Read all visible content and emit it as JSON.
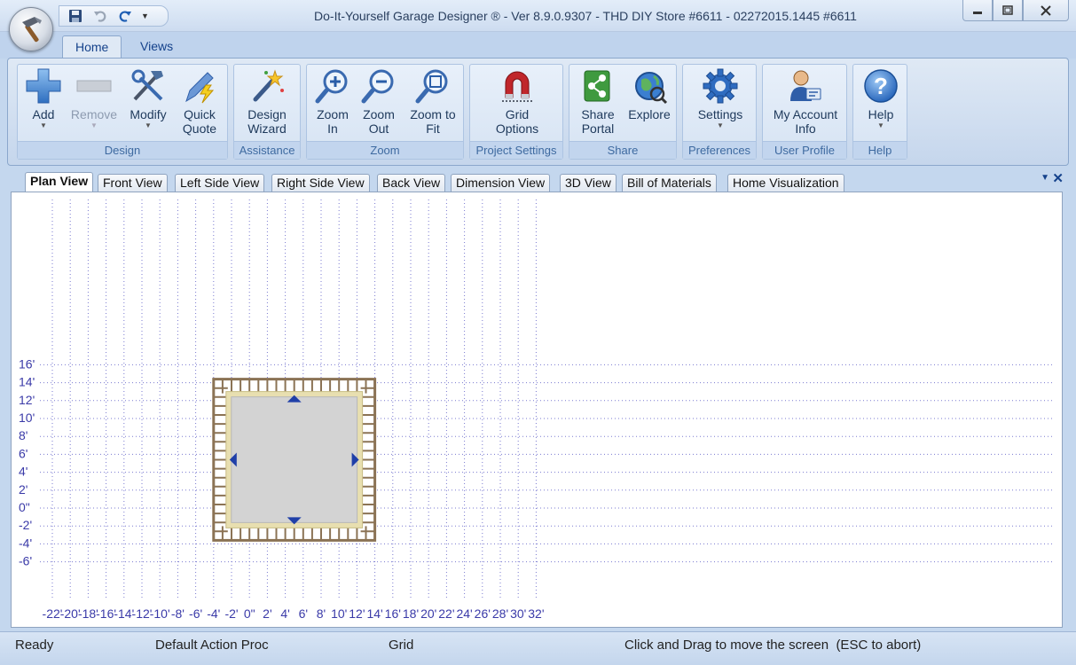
{
  "window": {
    "title": "Do-It-Yourself Garage Designer ® - Ver 8.9.0.9307 - THD DIY Store #6611 - 02272015.1445 #6611"
  },
  "quick_access": [
    "save-icon",
    "undo-icon",
    "redo-icon",
    "customize-dropdown"
  ],
  "ribbon_tabs": [
    {
      "label": "Home",
      "active": true
    },
    {
      "label": "Views",
      "active": false
    }
  ],
  "ribbon_groups": [
    {
      "label": "Design",
      "buttons": [
        {
          "line1": "Add",
          "line2": "",
          "icon": "plus-icon",
          "dropdown": true,
          "enabled": true
        },
        {
          "line1": "Remove",
          "line2": "",
          "icon": "minus-icon",
          "dropdown": true,
          "enabled": false
        },
        {
          "line1": "Modify",
          "line2": "",
          "icon": "tools-icon",
          "dropdown": true,
          "enabled": true
        },
        {
          "line1": "Quick",
          "line2": "Quote",
          "icon": "pen-lightning-icon",
          "dropdown": false,
          "enabled": true
        }
      ]
    },
    {
      "label": "Assistance",
      "buttons": [
        {
          "line1": "Design",
          "line2": "Wizard",
          "icon": "magic-wand-icon",
          "dropdown": false,
          "enabled": true
        }
      ]
    },
    {
      "label": "Zoom",
      "buttons": [
        {
          "line1": "Zoom",
          "line2": "In",
          "icon": "zoom-in-icon",
          "dropdown": false,
          "enabled": true
        },
        {
          "line1": "Zoom",
          "line2": "Out",
          "icon": "zoom-out-icon",
          "dropdown": false,
          "enabled": true
        },
        {
          "line1": "Zoom to",
          "line2": "Fit",
          "icon": "zoom-fit-icon",
          "dropdown": false,
          "enabled": true
        }
      ]
    },
    {
      "label": "Project Settings",
      "buttons": [
        {
          "line1": "Grid",
          "line2": "Options",
          "icon": "magnet-icon",
          "dropdown": false,
          "enabled": true
        }
      ]
    },
    {
      "label": "Share",
      "buttons": [
        {
          "line1": "Share",
          "line2": "Portal",
          "icon": "share-portal-icon",
          "dropdown": false,
          "enabled": true
        },
        {
          "line1": "Explore",
          "line2": "",
          "icon": "globe-icon",
          "dropdown": false,
          "enabled": true
        }
      ]
    },
    {
      "label": "Preferences",
      "buttons": [
        {
          "line1": "Settings",
          "line2": "",
          "icon": "gear-icon",
          "dropdown": true,
          "enabled": true
        }
      ]
    },
    {
      "label": "User Profile",
      "buttons": [
        {
          "line1": "My Account",
          "line2": "Info",
          "icon": "user-account-icon",
          "dropdown": false,
          "enabled": true
        }
      ]
    },
    {
      "label": "Help",
      "buttons": [
        {
          "line1": "Help",
          "line2": "",
          "icon": "help-icon",
          "dropdown": true,
          "enabled": true
        }
      ]
    }
  ],
  "view_tabs": [
    {
      "label": "Plan View",
      "active": true
    },
    {
      "label": "Front View",
      "active": false
    },
    {
      "label": "Left Side View",
      "active": false
    },
    {
      "label": "Right Side View",
      "active": false
    },
    {
      "label": "Back View",
      "active": false
    },
    {
      "label": "Dimension View",
      "active": false
    },
    {
      "label": "3D View",
      "active": false
    },
    {
      "label": "Bill of Materials",
      "active": false
    },
    {
      "label": "Home Visualization",
      "active": false
    }
  ],
  "plan": {
    "x_labels": [
      "-22'",
      "-20'",
      "-18'",
      "-16'",
      "-14'",
      "-12'",
      "-10'",
      "-8'",
      "-6'",
      "-4'",
      "-2'",
      "0\"",
      "2'",
      "4'",
      "6'",
      "8'",
      "10'",
      "12'",
      "14'",
      "16'",
      "18'",
      "20'",
      "22'",
      "24'",
      "26'",
      "28'",
      "30'",
      "32'"
    ],
    "y_labels": [
      "16'",
      "14'",
      "12'",
      "10'",
      "8'",
      "6'",
      "4'",
      "2'",
      "0\"",
      "-2'",
      "-4'",
      "-6'"
    ],
    "garage": {
      "x_min_ft": -4,
      "x_max_ft": 14,
      "y_min_ft": -4,
      "y_max_ft": 14,
      "inner_x_min_ft": -3.2,
      "inner_x_max_ft": 13.2,
      "inner_y_min_ft": -3.2,
      "inner_y_max_ft": 13.2
    },
    "colors": {
      "grid": "#7a7ad0",
      "label": "#3a3aa8",
      "frame": "#8b7355",
      "trim": "#e8dfb0",
      "floor": "#d3d3d3",
      "handle": "#1f3fa8"
    }
  },
  "status": {
    "ready": "Ready",
    "action": "Default Action Proc",
    "grid": "Grid",
    "hint": "Click and Drag to move the screen  (ESC to abort)"
  }
}
